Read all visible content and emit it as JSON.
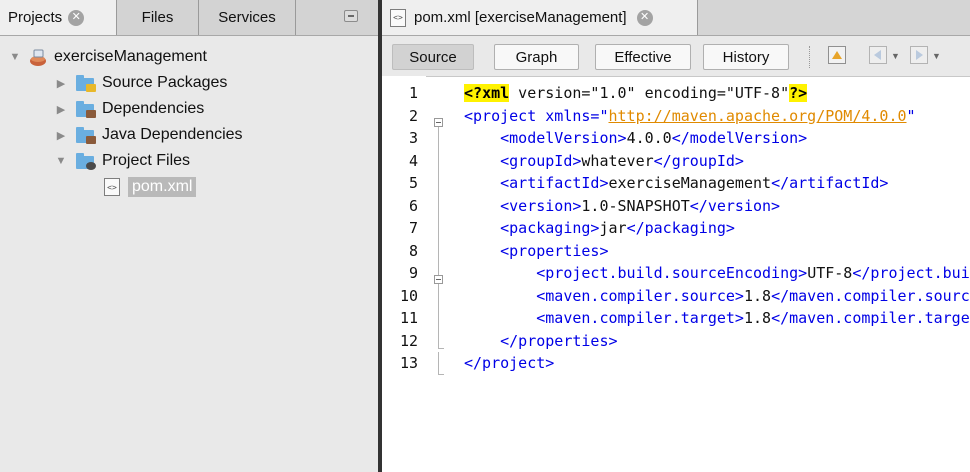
{
  "left_panel": {
    "tabs": [
      {
        "label": "Projects",
        "closable": true
      },
      {
        "label": "Files"
      },
      {
        "label": "Services"
      }
    ],
    "tree": [
      {
        "label": "exerciseManagement",
        "icon": "maven-project-icon",
        "expanded": true
      },
      {
        "label": "Source Packages",
        "icon": "source-packages-icon",
        "expanded": false
      },
      {
        "label": "Dependencies",
        "icon": "dependencies-icon",
        "expanded": false
      },
      {
        "label": "Java Dependencies",
        "icon": "java-dependencies-icon",
        "expanded": false
      },
      {
        "label": "Project Files",
        "icon": "project-files-icon",
        "expanded": true
      },
      {
        "label": "pom.xml",
        "icon": "xml-file-icon",
        "selected": true
      }
    ]
  },
  "editor": {
    "tab_title": "pom.xml [exerciseManagement]",
    "views": [
      "Source",
      "Graph",
      "Effective",
      "History"
    ],
    "active_view": "Source",
    "line_numbers": [
      "1",
      "2",
      "3",
      "4",
      "5",
      "6",
      "7",
      "8",
      "9",
      "10",
      "11",
      "12",
      "13"
    ],
    "lines": [
      [
        {
          "t": "pi",
          "v": "<?"
        },
        {
          "t": "pi",
          "v": "xml"
        },
        {
          "t": "txt",
          "v": " version=\"1.0\" encoding=\"UTF-8\""
        },
        {
          "t": "pi",
          "v": "?>"
        }
      ],
      [
        {
          "t": "tag",
          "v": "<project xmlns=\""
        },
        {
          "t": "url",
          "v": "http://maven.apache.org/POM/4.0.0"
        },
        {
          "t": "tag",
          "v": "\""
        }
      ],
      [
        {
          "t": "sp",
          "v": "    "
        },
        {
          "t": "tag",
          "v": "<modelVersion>"
        },
        {
          "t": "txt",
          "v": "4.0.0"
        },
        {
          "t": "tag",
          "v": "</modelVersion>"
        }
      ],
      [
        {
          "t": "sp",
          "v": "    "
        },
        {
          "t": "tag",
          "v": "<groupId>"
        },
        {
          "t": "txt",
          "v": "whatever"
        },
        {
          "t": "tag",
          "v": "</groupId>"
        }
      ],
      [
        {
          "t": "sp",
          "v": "    "
        },
        {
          "t": "tag",
          "v": "<artifactId>"
        },
        {
          "t": "txt",
          "v": "exerciseManagement"
        },
        {
          "t": "tag",
          "v": "</artifactId>"
        }
      ],
      [
        {
          "t": "sp",
          "v": "    "
        },
        {
          "t": "tag",
          "v": "<version>"
        },
        {
          "t": "txt",
          "v": "1.0-SNAPSHOT"
        },
        {
          "t": "tag",
          "v": "</version>"
        }
      ],
      [
        {
          "t": "sp",
          "v": "    "
        },
        {
          "t": "tag",
          "v": "<packaging>"
        },
        {
          "t": "txt",
          "v": "jar"
        },
        {
          "t": "tag",
          "v": "</packaging>"
        }
      ],
      [
        {
          "t": "sp",
          "v": "    "
        },
        {
          "t": "tag",
          "v": "<properties>"
        }
      ],
      [
        {
          "t": "sp",
          "v": "        "
        },
        {
          "t": "tag",
          "v": "<project.build.sourceEncoding>"
        },
        {
          "t": "txt",
          "v": "UTF-8"
        },
        {
          "t": "tag",
          "v": "</project.build.sourceEncoding>"
        }
      ],
      [
        {
          "t": "sp",
          "v": "        "
        },
        {
          "t": "tag",
          "v": "<maven.compiler.source>"
        },
        {
          "t": "txt",
          "v": "1.8"
        },
        {
          "t": "tag",
          "v": "</maven.compiler.source>"
        }
      ],
      [
        {
          "t": "sp",
          "v": "        "
        },
        {
          "t": "tag",
          "v": "<maven.compiler.target>"
        },
        {
          "t": "txt",
          "v": "1.8"
        },
        {
          "t": "tag",
          "v": "</maven.compiler.target>"
        }
      ],
      [
        {
          "t": "sp",
          "v": "    "
        },
        {
          "t": "tag",
          "v": "</properties>"
        }
      ],
      [
        {
          "t": "tag",
          "v": "</project>"
        }
      ]
    ]
  },
  "colors": {
    "tag": "#0000e6",
    "url": "#e08a00",
    "pi_highlight": "#fff200",
    "splitter": "#333333",
    "panel_bg": "#e9e9e9"
  }
}
